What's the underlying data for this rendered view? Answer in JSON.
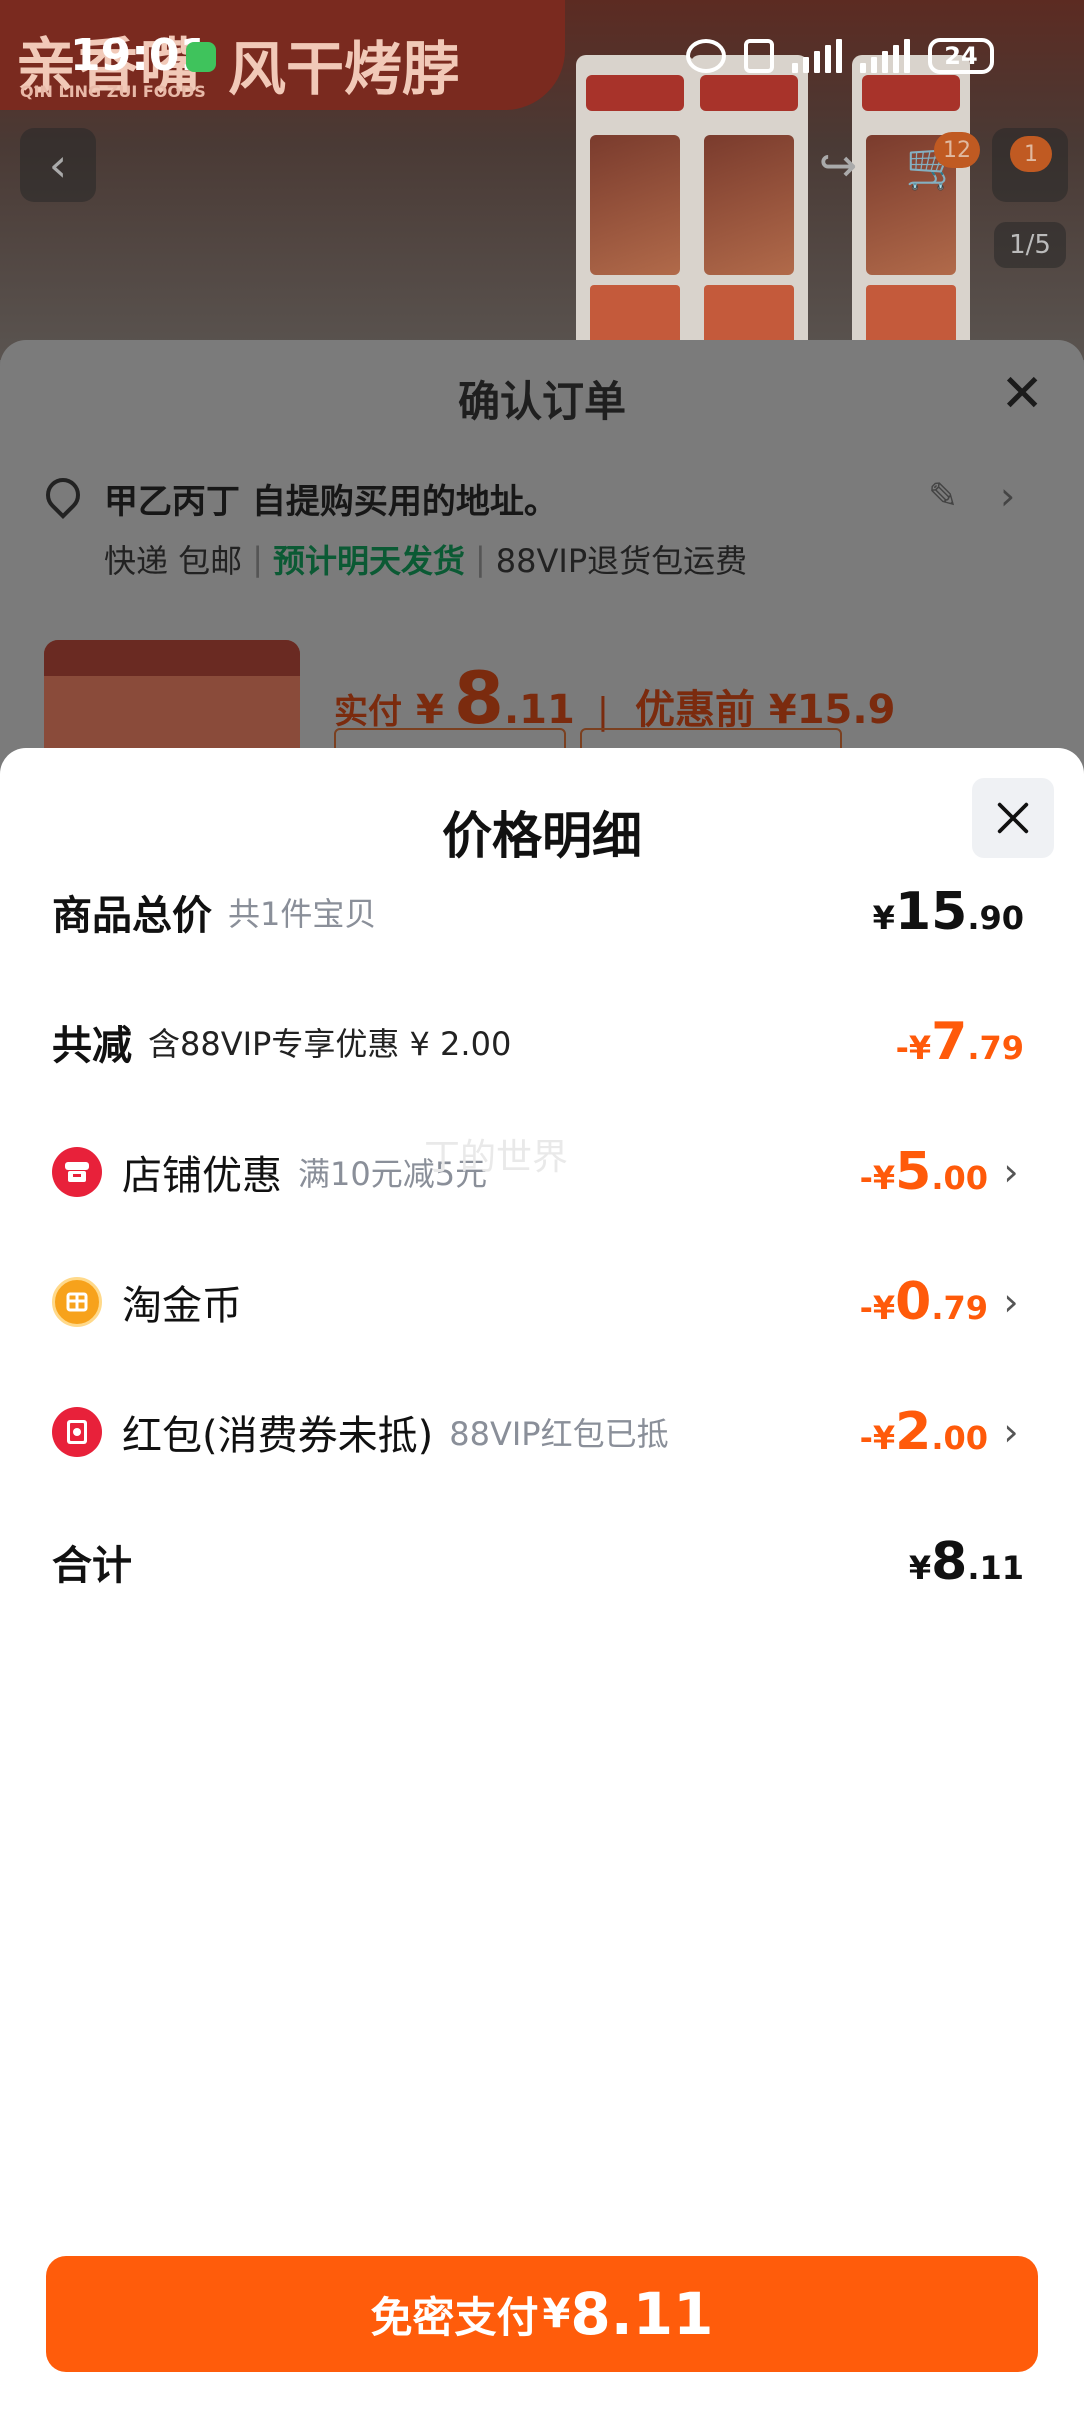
{
  "status_bar": {
    "time": "19:01",
    "battery": "24"
  },
  "background": {
    "brand_name": "亲香嘴",
    "brand_en": "QIN LING ZUI FOODS",
    "product_name": "风干烤脖",
    "photo_count": "1/5",
    "cart_badge": "12",
    "more_badge": "1"
  },
  "order": {
    "title": "确认订单",
    "address": "甲乙丙丁 自提购买用的地址。",
    "shipping": {
      "method": "快递 包邮",
      "eta": "预计明天发货",
      "return": "88VIP退货包运费"
    },
    "pay_label": "实付",
    "pay_currency": "¥",
    "pay_int": "8",
    "pay_dec": ".11",
    "before_discount": "优惠前 ¥15.9"
  },
  "price_detail": {
    "title": "价格明细",
    "rows": [
      {
        "name": "total",
        "title": "商品总价",
        "sub": "共1件宝贝",
        "cur": "¥",
        "int": "15",
        "dec": ".90"
      },
      {
        "name": "discount",
        "title": "共减",
        "sub": "含88VIP专享优惠 ¥ 2.00",
        "cur": "-¥",
        "int": "7",
        "dec": ".79"
      },
      {
        "name": "shop-coupon",
        "title": "店铺优惠",
        "sub": "满10元减5元",
        "cur": "-¥",
        "int": "5",
        "dec": ".00"
      },
      {
        "name": "taojin-coin",
        "title": "淘金币",
        "sub": "",
        "cur": "-¥",
        "int": "0",
        "dec": ".79"
      },
      {
        "name": "red-packet",
        "title": "红包(消费券未抵)",
        "sub": "88VIP红包已抵",
        "cur": "-¥",
        "int": "2",
        "dec": ".00"
      },
      {
        "name": "sum",
        "title": "合计",
        "sub": "",
        "cur": "¥",
        "int": "8",
        "dec": ".11"
      }
    ],
    "watermark": "丁的世界"
  },
  "pay_button": {
    "label": "免密支付",
    "cur": "¥",
    "amount": "8.11"
  },
  "colors": {
    "accent": "#ff5c0b",
    "price_orange": "#ff5a0a",
    "shop_icon": "#e8213a",
    "coin_icon": "#f7a21b"
  }
}
